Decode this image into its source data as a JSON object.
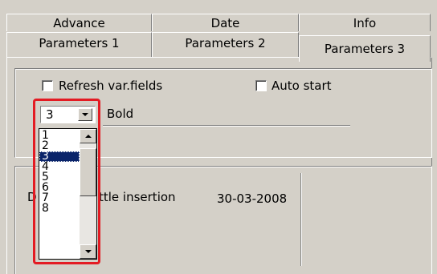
{
  "tabs_row1": [
    "Advance",
    "Date",
    "Info"
  ],
  "tabs_row2": [
    "Parameters 1",
    "Parameters 2",
    "Parameters 3"
  ],
  "active_tab": "Parameters 3",
  "options": {
    "refresh_label": "Refresh var.fields",
    "refresh_checked": false,
    "auto_start_label": "Auto start",
    "auto_start_checked": false
  },
  "font_size_select": {
    "value": "3",
    "style_label": "Bold",
    "options": [
      "1",
      "2",
      "3",
      "4",
      "5",
      "6",
      "7",
      "8"
    ],
    "highlighted": "3"
  },
  "info_row": {
    "label_prefix": "D",
    "label_suffix": "ttle insertion",
    "date": "30-03-2008"
  },
  "colors": {
    "face": "#d4d0c8",
    "selection": "#0a246a",
    "annotation": "#e31b23"
  }
}
